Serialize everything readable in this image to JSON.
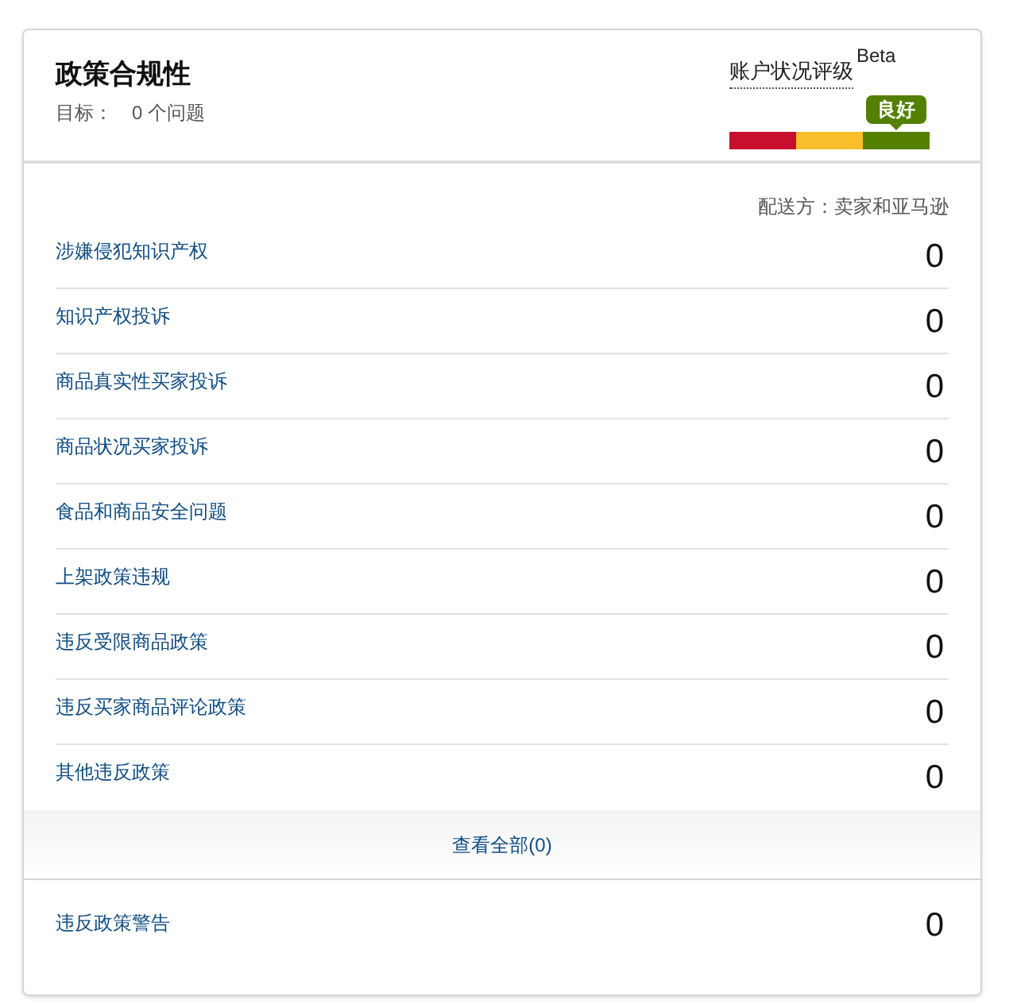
{
  "header": {
    "title": "政策合规性",
    "target_label": "目标：",
    "target_value": "0 个问题",
    "rating_label": "账户状况评级",
    "rating_badge": "Beta",
    "rating_segments": [
      {
        "color": "#c8102e",
        "selected": false
      },
      {
        "color": "#f8bf2b",
        "selected": false
      },
      {
        "color": "#538000",
        "selected": true,
        "label": "良好"
      }
    ]
  },
  "fulfilled_by": "配送方：卖家和亚马逊",
  "rows": [
    {
      "label": "涉嫌侵犯知识产权",
      "count": "0"
    },
    {
      "label": "知识产权投诉",
      "count": "0"
    },
    {
      "label": "商品真实性买家投诉",
      "count": "0"
    },
    {
      "label": "商品状况买家投诉",
      "count": "0"
    },
    {
      "label": "食品和商品安全问题",
      "count": "0"
    },
    {
      "label": "上架政策违规",
      "count": "0"
    },
    {
      "label": "违反受限商品政策",
      "count": "0"
    },
    {
      "label": "违反买家商品评论政策",
      "count": "0"
    },
    {
      "label": "其他违反政策",
      "count": "0"
    }
  ],
  "view_all": "查看全部(0)",
  "warnings": {
    "label": "违反政策警告",
    "count": "0"
  }
}
